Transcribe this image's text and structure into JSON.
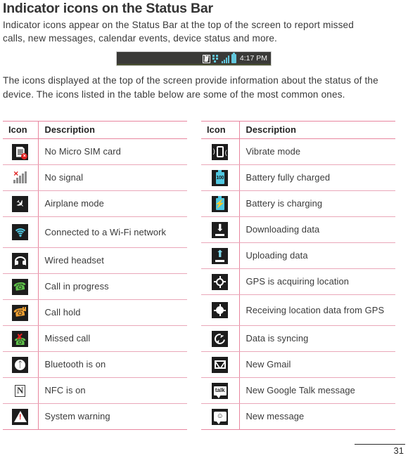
{
  "heading": "Indicator icons on the Status Bar",
  "intro_paragraph": "Indicator icons appear on the Status Bar at the top of the screen to report missed calls, new messages, calendar events, device status and more.",
  "status_bar_figure": {
    "time": "4:17 PM",
    "icons": [
      "nfc-icon",
      "data-transfer-icon",
      "signal-bars-icon",
      "battery-icon"
    ],
    "background_color": "#3a3a38"
  },
  "second_paragraph": "The icons displayed at the top of the screen provide information about the status of the device. The icons listed in the table below are some of the most common ones.",
  "accent_color": "#e8869f",
  "tables": [
    {
      "headers": [
        "Icon",
        "Description"
      ],
      "rows": [
        {
          "icon": "no-micro-sim-icon",
          "description": "No Micro SIM card"
        },
        {
          "icon": "no-signal-icon",
          "description": "No signal"
        },
        {
          "icon": "airplane-mode-icon",
          "description": "Airplane mode"
        },
        {
          "icon": "wifi-connected-icon",
          "description": "Connected to a Wi-Fi network"
        },
        {
          "icon": "wired-headset-icon",
          "description": "Wired headset"
        },
        {
          "icon": "call-in-progress-icon",
          "description": "Call in progress"
        },
        {
          "icon": "call-hold-icon",
          "description": "Call hold"
        },
        {
          "icon": "missed-call-icon",
          "description": "Missed call"
        },
        {
          "icon": "bluetooth-on-icon",
          "description": "Bluetooth is on"
        },
        {
          "icon": "nfc-on-icon",
          "description": "NFC is on"
        },
        {
          "icon": "system-warning-icon",
          "description": "System warning"
        }
      ]
    },
    {
      "headers": [
        "Icon",
        "Description"
      ],
      "rows": [
        {
          "icon": "vibrate-mode-icon",
          "description": "Vibrate mode"
        },
        {
          "icon": "battery-full-icon",
          "description": "Battery fully charged",
          "icon_label": "100"
        },
        {
          "icon": "battery-charging-icon",
          "description": "Battery is charging"
        },
        {
          "icon": "downloading-data-icon",
          "description": "Downloading data"
        },
        {
          "icon": "uploading-data-icon",
          "description": "Uploading data"
        },
        {
          "icon": "gps-acquiring-icon",
          "description": "GPS is acquiring location"
        },
        {
          "icon": "gps-receiving-icon",
          "description": "Receiving location data from GPS"
        },
        {
          "icon": "data-syncing-icon",
          "description": "Data is syncing"
        },
        {
          "icon": "new-gmail-icon",
          "description": "New Gmail"
        },
        {
          "icon": "new-google-talk-icon",
          "description": "New Google Talk message",
          "icon_label": "talk"
        },
        {
          "icon": "new-message-icon",
          "description": "New message"
        }
      ]
    }
  ],
  "page_number": "31"
}
